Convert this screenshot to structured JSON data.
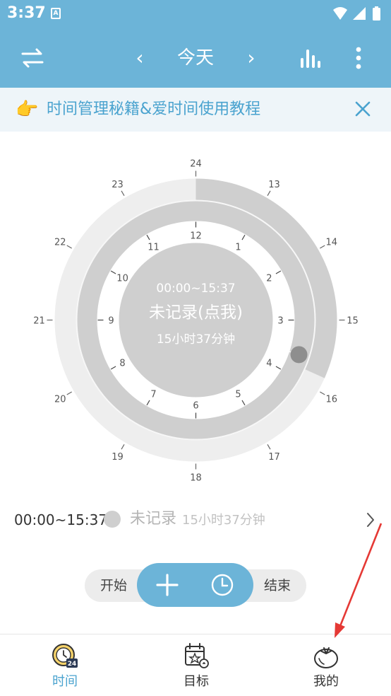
{
  "status_bar": {
    "time": "3:37",
    "notification_icon": "A"
  },
  "app_bar": {
    "title": "今天",
    "prev_label": "‹",
    "next_label": "›"
  },
  "banner": {
    "emoji": "👉",
    "text": "时间管理秘籍&爱时间使用教程"
  },
  "dial": {
    "center_range": "00:00~15:37",
    "center_label": "未记录(点我)",
    "center_duration": "15小时37分钟",
    "outer_hours": [
      "24",
      "13",
      "14",
      "15",
      "16",
      "17",
      "18",
      "19",
      "20",
      "21",
      "22",
      "23"
    ],
    "inner_hours": [
      "12",
      "1",
      "2",
      "3",
      "4",
      "5",
      "6",
      "7",
      "8",
      "9",
      "10",
      "11"
    ],
    "outer_elapsed_fraction": 0.3173,
    "inner_elapsed_hours": 15.617
  },
  "entry": {
    "range": "00:00~15:37",
    "label": "未记录",
    "duration": "15小时37分钟"
  },
  "controls": {
    "start_label": "开始",
    "end_label": "结束"
  },
  "bottom_nav": [
    {
      "label": "时间",
      "active": true,
      "icon": "clock-24-icon",
      "badge": "24"
    },
    {
      "label": "目标",
      "active": false,
      "icon": "calendar-target-icon"
    },
    {
      "label": "我的",
      "active": false,
      "icon": "tomato-icon"
    }
  ],
  "colors": {
    "accent": "#6cb4d8",
    "accent_text": "#4aa3cf",
    "ring_dark": "#cfcfcf",
    "ring_light": "#eeeeee",
    "annotation": "#e53935"
  }
}
